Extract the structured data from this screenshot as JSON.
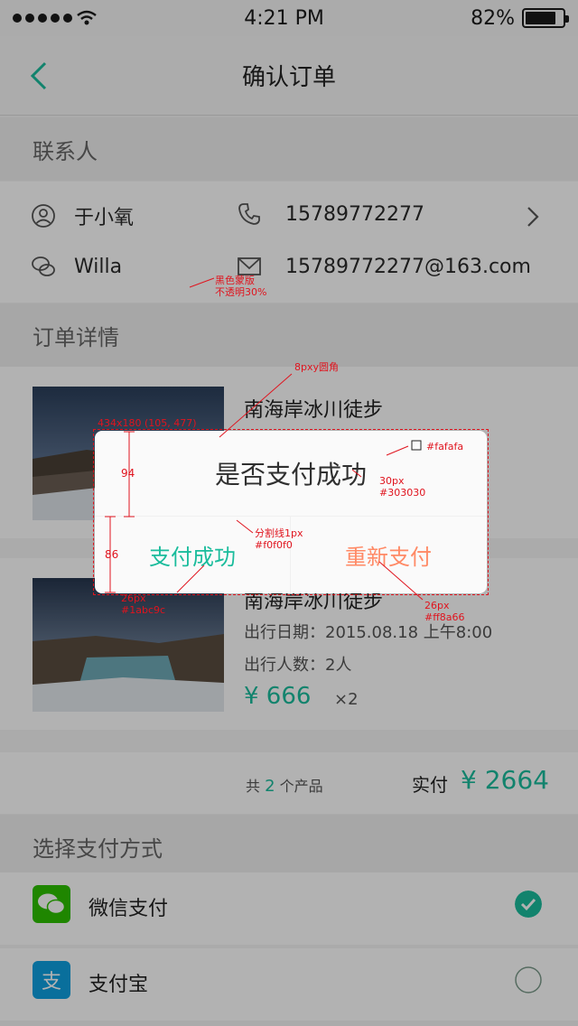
{
  "status_bar": {
    "time": "4:21 PM",
    "battery_pct": "82%",
    "battery_level": 0.82
  },
  "nav": {
    "title": "确认订单",
    "back_icon": "chevron-left-icon"
  },
  "contact": {
    "section_title": "联系人",
    "name": "于小氧",
    "phone": "15789772277",
    "nickname": "Willa",
    "email": "15789772277@163.com"
  },
  "order": {
    "section_title": "订单详情",
    "items": [
      {
        "title": "南海岸冰川徒步",
        "date": "",
        "travelers": "",
        "price": "",
        "qty": ""
      },
      {
        "title": "南海岸冰川徒步",
        "date": "出行日期：2015.08.18  上午8:00",
        "travelers": "出行人数：2人",
        "price": "¥ 666",
        "qty": "×2"
      }
    ]
  },
  "summary": {
    "count_prefix": "共",
    "count": "2",
    "count_suffix": "个产品",
    "total_label": "实付",
    "total": "¥ 2664"
  },
  "payment": {
    "section_title": "选择支付方式",
    "methods": [
      {
        "name": "微信支付",
        "selected": true
      },
      {
        "name": "支付宝",
        "selected": false
      }
    ]
  },
  "dialog": {
    "title": "是否支付成功",
    "ok_label": "支付成功",
    "retry_label": "重新支付"
  },
  "annotations": {
    "mask": "黑色蒙版\n不透明30%",
    "radius": "8pxy圆角",
    "size": "434x180 (105, 477)",
    "bg": "#fafafa",
    "title_font": "30px\n#303030",
    "divider": "分割线1px\n#f0f0f0",
    "ok_font": "26px\n#1abc9c",
    "retry_font": "26px\n#ff8a66",
    "h1": "94",
    "h2": "86"
  },
  "colors": {
    "accent": "#1abc9c",
    "retry": "#ff8a66",
    "title": "#303030",
    "divider": "#f0f0f0",
    "dialog_bg": "#fafafa",
    "wechat": "#2dc100",
    "alipay": "#0ea0e0"
  }
}
